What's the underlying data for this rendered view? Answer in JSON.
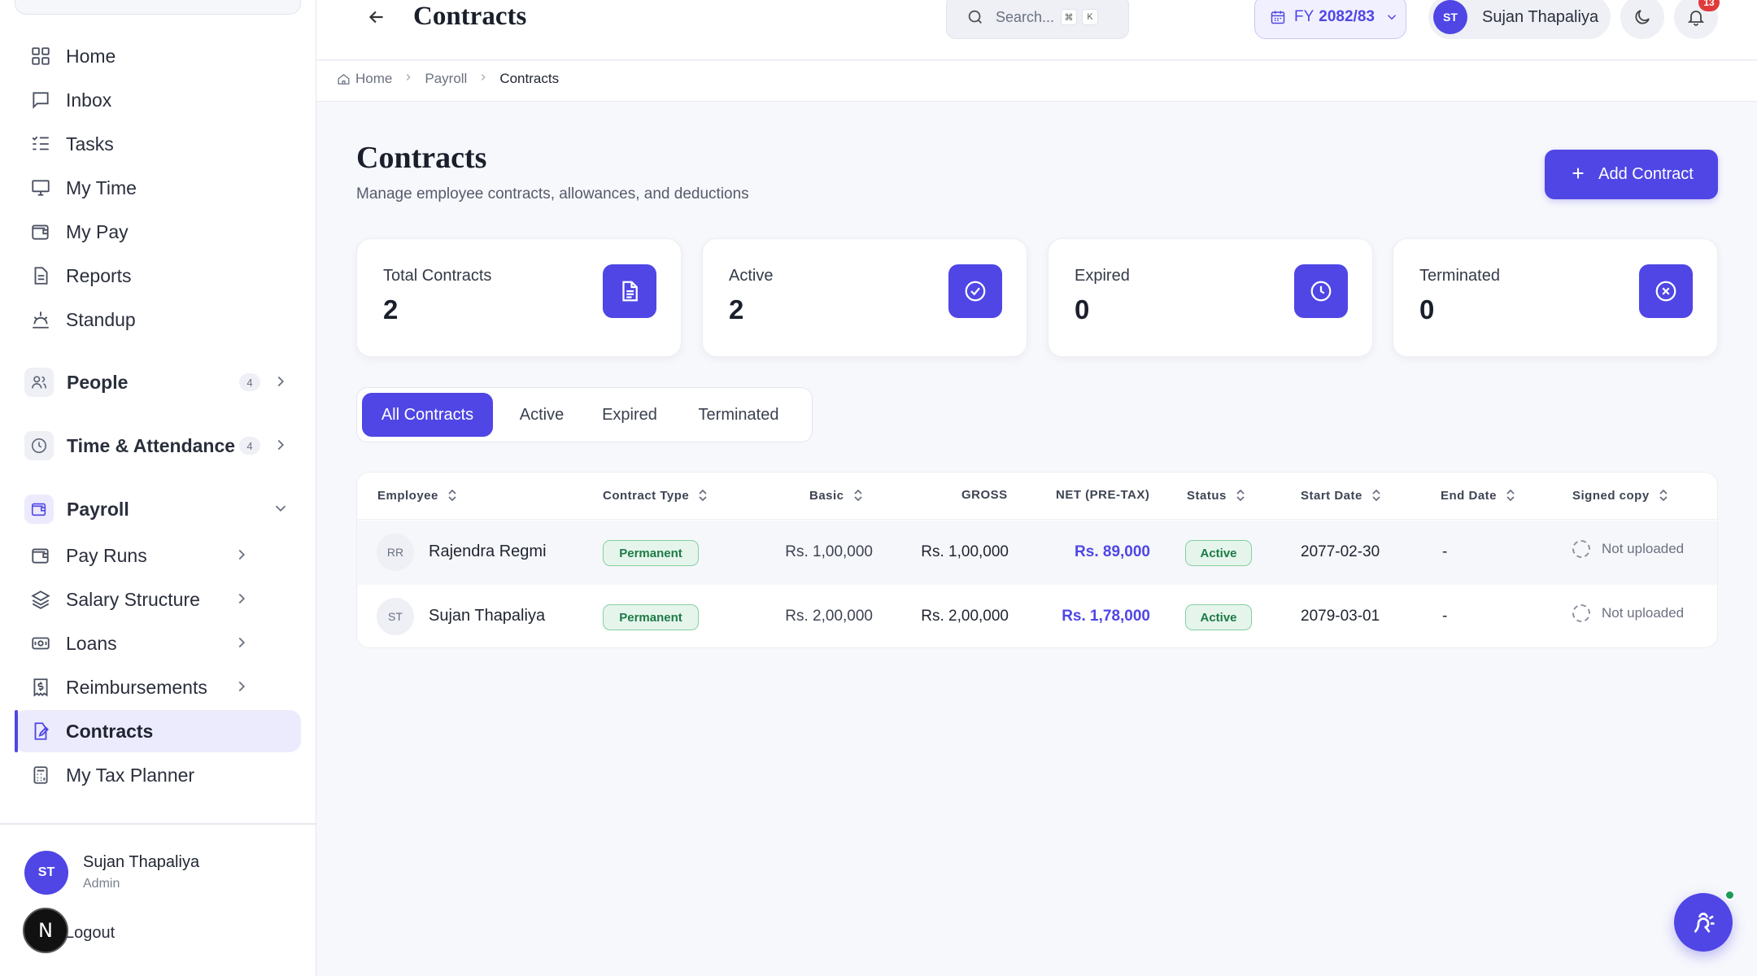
{
  "header": {
    "title": "Contracts",
    "search_placeholder": "Search...",
    "kbd_cmd": "⌘",
    "kbd_key": "K",
    "fy_prefix": "FY",
    "fy_value": "2082/83",
    "user_initials": "ST",
    "user_name": "Sujan Thapaliya",
    "notification_count": "13"
  },
  "breadcrumb": [
    "Home",
    "Payroll",
    "Contracts"
  ],
  "sidebar": {
    "items": [
      {
        "label": "Home",
        "icon": "grid-icon"
      },
      {
        "label": "Inbox",
        "icon": "message-icon"
      },
      {
        "label": "Tasks",
        "icon": "checklist-icon"
      },
      {
        "label": "My Time",
        "icon": "monitor-icon"
      },
      {
        "label": "My Pay",
        "icon": "wallet-icon"
      },
      {
        "label": "Reports",
        "icon": "document-icon"
      },
      {
        "label": "Standup",
        "icon": "sunrise-icon"
      }
    ],
    "groups": [
      {
        "label": "People",
        "badge": "4",
        "icon": "users-icon"
      },
      {
        "label": "Time & Attendance",
        "badge": "4",
        "icon": "clock-icon"
      },
      {
        "label": "Payroll",
        "icon": "wallet-icon"
      }
    ],
    "payroll_items": [
      {
        "label": "Pay Runs",
        "icon": "wallet-icon"
      },
      {
        "label": "Salary Structure",
        "icon": "layers-icon"
      },
      {
        "label": "Loans",
        "icon": "banknote-icon"
      },
      {
        "label": "Reimbursements",
        "icon": "receipt-icon"
      },
      {
        "label": "Contracts",
        "icon": "file-edit-icon"
      },
      {
        "label": "My Tax Planner",
        "icon": "calculator-icon"
      }
    ],
    "user": {
      "initials": "ST",
      "name": "Sujan Thapaliya",
      "role": "Admin"
    },
    "logout_label": "Logout",
    "n_badge": "N"
  },
  "page": {
    "title": "Contracts",
    "subtitle": "Manage employee contracts, allowances, and deductions",
    "add_button": "Add Contract"
  },
  "stats": [
    {
      "label": "Total Contracts",
      "value": "2",
      "icon": "document-icon"
    },
    {
      "label": "Active",
      "value": "2",
      "icon": "check-circle-icon"
    },
    {
      "label": "Expired",
      "value": "0",
      "icon": "clock-icon"
    },
    {
      "label": "Terminated",
      "value": "0",
      "icon": "x-circle-icon"
    }
  ],
  "tabs": [
    "All Contracts",
    "Active",
    "Expired",
    "Terminated"
  ],
  "active_tab": "All Contracts",
  "table": {
    "columns": [
      "Employee",
      "Contract Type",
      "Basic",
      "GROSS",
      "NET (PRE-TAX)",
      "Status",
      "Start Date",
      "End Date",
      "Signed copy"
    ],
    "rows": [
      {
        "initials": "RR",
        "name": "Rajendra Regmi",
        "type": "Permanent",
        "basic": "Rs. 1,00,000",
        "gross": "Rs. 1,00,000",
        "net": "Rs. 89,000",
        "status": "Active",
        "start": "2077-02-30",
        "end": "-",
        "signed": "Not uploaded"
      },
      {
        "initials": "ST",
        "name": "Sujan Thapaliya",
        "type": "Permanent",
        "basic": "Rs. 2,00,000",
        "gross": "Rs. 2,00,000",
        "net": "Rs. 1,78,000",
        "status": "Active",
        "start": "2079-03-01",
        "end": "-",
        "signed": "Not uploaded"
      }
    ]
  },
  "colors": {
    "accent": "#4f46e5",
    "success": "#1d7a46",
    "notification": "#e03b3b"
  }
}
